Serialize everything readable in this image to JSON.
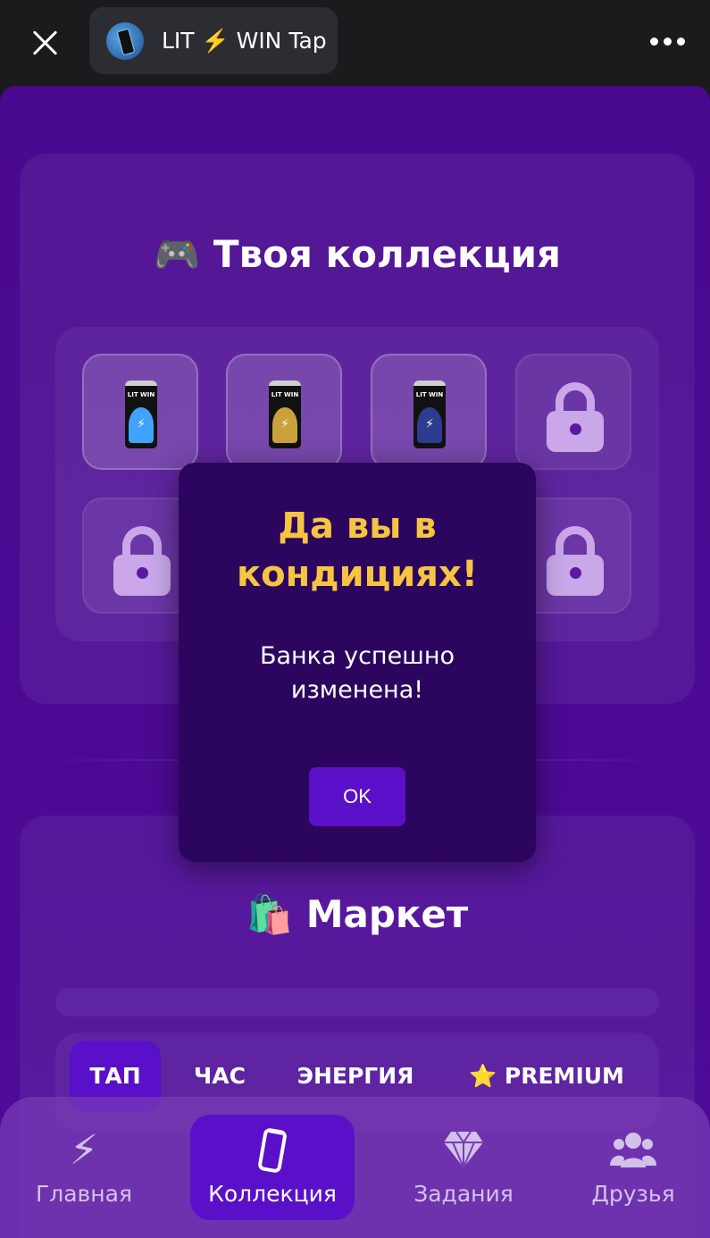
{
  "header": {
    "close_icon": "close-icon",
    "app_title": "LIT ⚡️ WIN Tap",
    "more_icon": "more-horizontal-icon"
  },
  "collection": {
    "title_emoji": "🎮",
    "title": "Твоя коллекция",
    "slots": [
      {
        "state": "owned",
        "can": "LIT WIN classic blue",
        "label": "LIT WIN"
      },
      {
        "state": "owned",
        "can": "LIT WIN gold",
        "label": "LIT WIN"
      },
      {
        "state": "owned",
        "can": "LIT WIN dark blue",
        "label": "LIT WIN"
      },
      {
        "state": "locked",
        "icon": "lock-icon"
      },
      {
        "state": "locked",
        "icon": "lock-icon"
      },
      {
        "state": "locked",
        "icon": "lock-icon"
      },
      {
        "state": "locked",
        "icon": "lock-icon"
      },
      {
        "state": "locked",
        "icon": "lock-icon"
      }
    ]
  },
  "market": {
    "title_emoji": "🛍️",
    "title": "Маркет",
    "tabs": [
      {
        "label": "ТАП",
        "active": true
      },
      {
        "label": "ЧАС",
        "active": false
      },
      {
        "label": "ЭНЕРГИЯ",
        "active": false
      },
      {
        "label": "⭐ PREMIUM",
        "active": false
      }
    ]
  },
  "nav": {
    "items": [
      {
        "label": "Главная",
        "icon": "lightning-icon",
        "active": false
      },
      {
        "label": "Коллекция",
        "icon": "can-icon",
        "active": true
      },
      {
        "label": "Задания",
        "icon": "diamond-icon",
        "active": false
      },
      {
        "label": "Друзья",
        "icon": "users-icon",
        "active": false
      }
    ]
  },
  "modal": {
    "title": "Да вы в кондициях!",
    "message": "Банка успешно изменена!",
    "ok_label": "OK"
  },
  "colors": {
    "background": "#49098f",
    "accent": "#5a10c8",
    "modal_bg": "#2c055f",
    "modal_title": "#f5c542"
  }
}
